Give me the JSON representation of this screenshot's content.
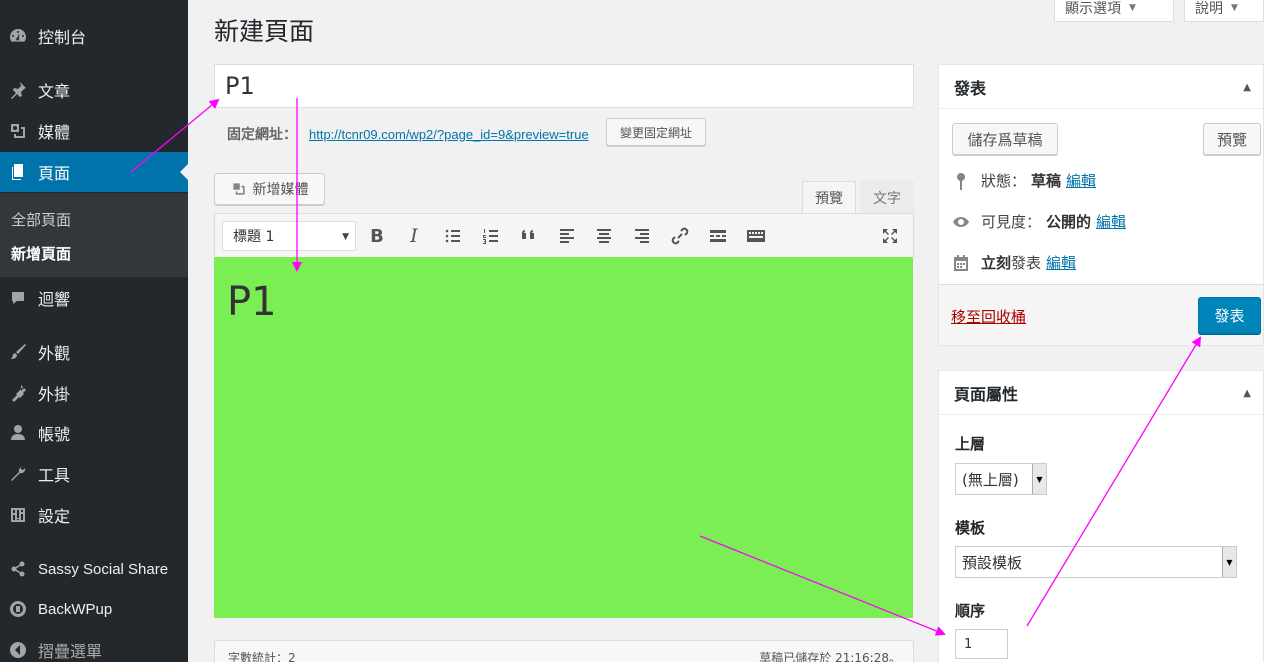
{
  "sidebar": {
    "items": [
      {
        "label": "控制台",
        "icon": "dashboard-icon"
      },
      {
        "label": "文章",
        "icon": "pin-icon"
      },
      {
        "label": "媒體",
        "icon": "media-icon"
      },
      {
        "label": "頁面",
        "icon": "pages-icon"
      },
      {
        "label": "迴響",
        "icon": "comment-icon"
      },
      {
        "label": "外觀",
        "icon": "brush-icon"
      },
      {
        "label": "外掛",
        "icon": "plugin-icon"
      },
      {
        "label": "帳號",
        "icon": "user-icon"
      },
      {
        "label": "工具",
        "icon": "wrench-icon"
      },
      {
        "label": "設定",
        "icon": "settings-icon"
      },
      {
        "label": "Sassy Social Share",
        "icon": "share-icon"
      },
      {
        "label": "BackWPup",
        "icon": "backwpup-icon"
      },
      {
        "label": "摺疊選單",
        "icon": "collapse-icon"
      }
    ],
    "submenu": [
      "全部頁面",
      "新增頁面"
    ]
  },
  "header": {
    "title": "新建頁面",
    "screen_options": "顯示選項",
    "help": "說明"
  },
  "editor": {
    "title_value": "P1",
    "permalink_label": "固定網址：",
    "permalink_url": "http://tcnr09.com/wp2/?page_id=9&preview=true",
    "change_permalink": "變更固定網址",
    "add_media": "新增媒體",
    "tab_visual": "預覽",
    "tab_text": "文字",
    "format_select": "標題 1",
    "content_heading": "P1",
    "word_count": "字數統計：2",
    "draft_saved": "草稿已儲存於 21:16:28。"
  },
  "publish": {
    "title": "發表",
    "save_draft": "儲存爲草稿",
    "preview": "預覽",
    "status_label": "狀態：",
    "status_value": "草稿",
    "visibility_label": "可見度：",
    "visibility_value": "公開的",
    "schedule_label": "立刻",
    "schedule_suffix": "發表",
    "edit": "編輯",
    "trash": "移至回收桶",
    "publish_button": "發表"
  },
  "attributes": {
    "title": "頁面屬性",
    "parent_label": "上層",
    "parent_value": "(無上層)",
    "template_label": "模板",
    "template_value": "預設模板",
    "order_label": "順序",
    "order_value": "1"
  },
  "colors": {
    "sidebar_bg": "#23282d",
    "active_blue": "#0073aa",
    "content_bg": "#7aee52",
    "annotation_arrow": "#ff00ff"
  }
}
